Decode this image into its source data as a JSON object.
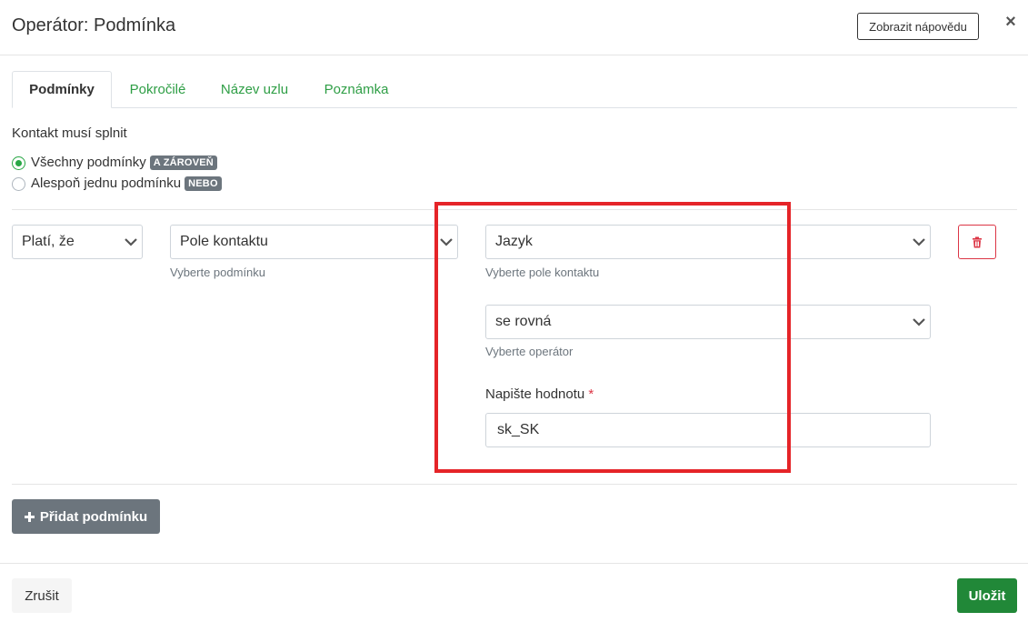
{
  "header": {
    "title": "Operátor: Podmínka",
    "help_button": "Zobrazit nápovědu",
    "close_icon": "×"
  },
  "tabs": [
    {
      "label": "Podmínky",
      "active": true
    },
    {
      "label": "Pokročilé",
      "active": false
    },
    {
      "label": "Název uzlu",
      "active": false
    },
    {
      "label": "Poznámka",
      "active": false
    }
  ],
  "match": {
    "label": "Kontakt musí splnit",
    "options": [
      {
        "label": "Všechny podmínky",
        "badge": "A ZÁROVEŇ",
        "checked": true
      },
      {
        "label": "Alespoň jednu podmínku",
        "badge": "NEBO",
        "checked": false
      }
    ]
  },
  "condition": {
    "prefix_select": "Platí, že",
    "type_select": "Pole kontaktu",
    "type_help": "Vyberte podmínku",
    "field_select": "Jazyk",
    "field_help": "Vyberte pole kontaktu",
    "operator_select": "se rovná",
    "operator_help": "Vyberte operátor",
    "value_label": "Napište hodnotu",
    "value_required_mark": "*",
    "value": "sk_SK"
  },
  "actions": {
    "add_condition": "Přidat podmínku",
    "add_icon": "plus-icon",
    "delete_icon": "trash-icon"
  },
  "footer": {
    "cancel": "Zrušit",
    "save": "Uložit"
  },
  "colors": {
    "accent_green": "#2e9e45",
    "save_green": "#218838",
    "danger": "#dc3545",
    "highlight_red": "#e52428",
    "badge_gray": "#6c757d"
  }
}
